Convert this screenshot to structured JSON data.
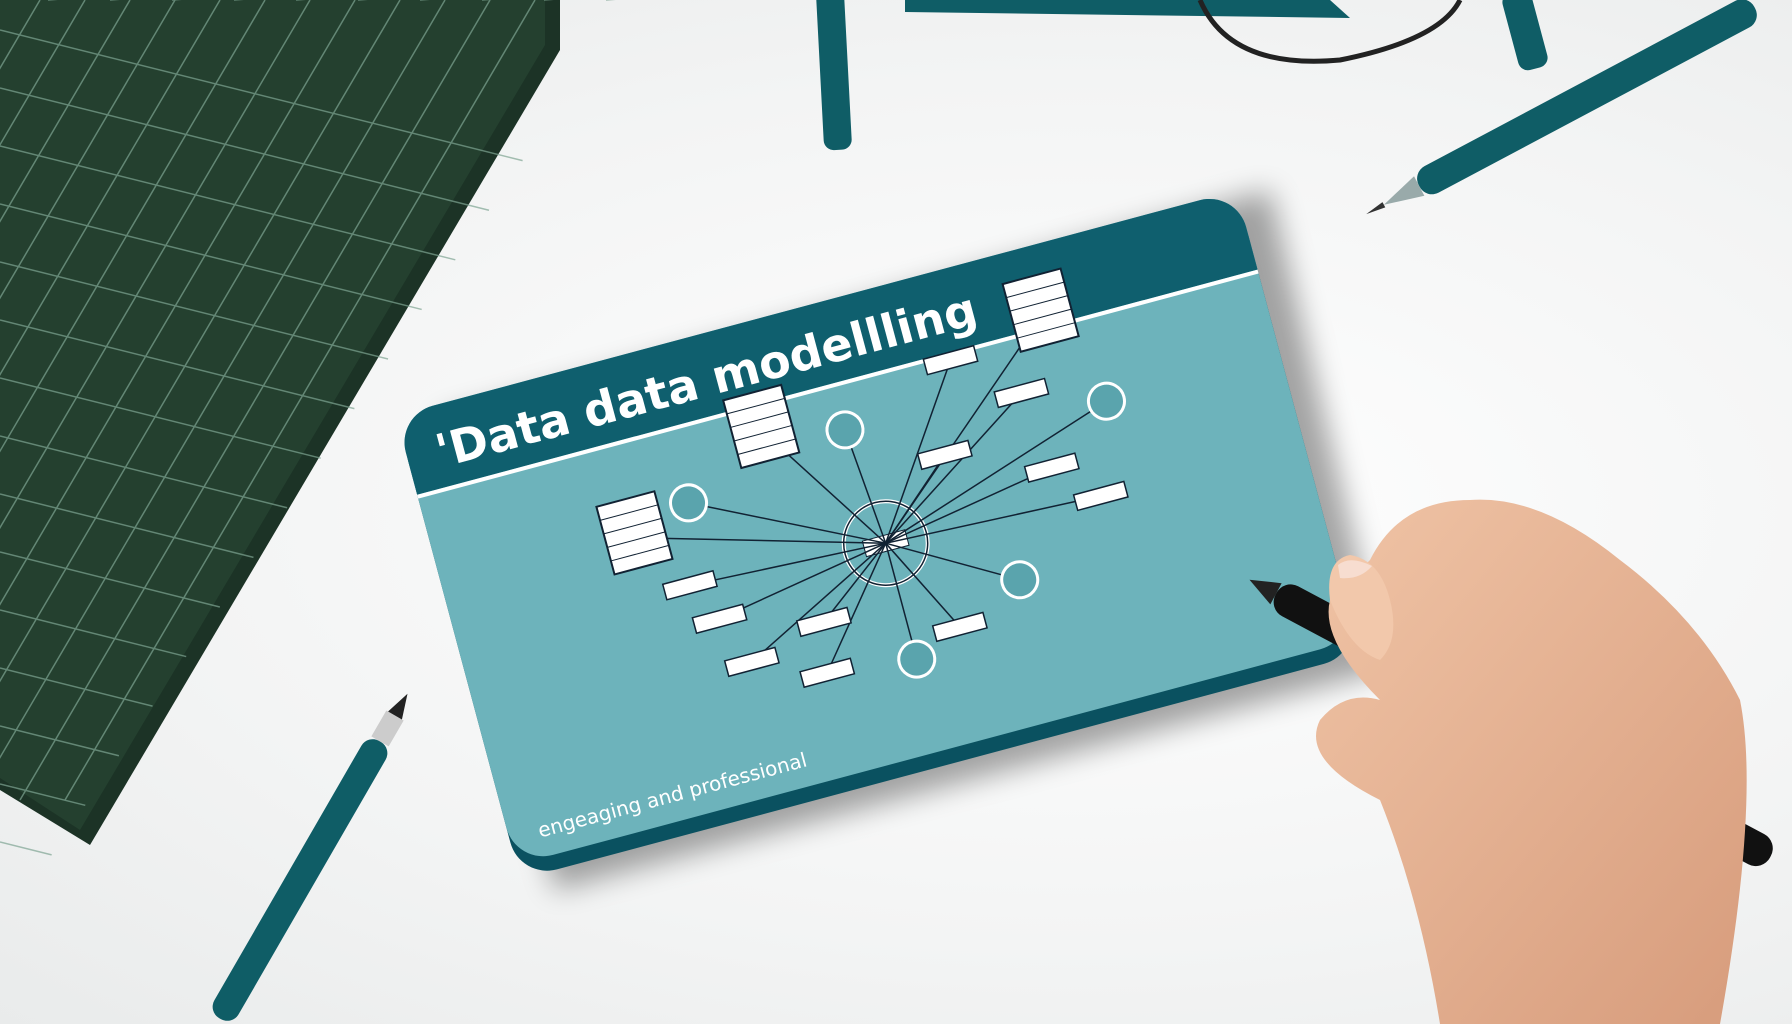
{
  "card": {
    "title": "'Data data modellling",
    "tagline": "engeaging and professional",
    "colors": {
      "header": "#0f5f6e",
      "body": "#6db3bb",
      "edge": "#0a5160"
    }
  },
  "scene": {
    "mat_color": "#1f3b2c",
    "pen_color": "#0f5d66",
    "marker_color": "#111111",
    "skin_color": "#e9b596"
  }
}
